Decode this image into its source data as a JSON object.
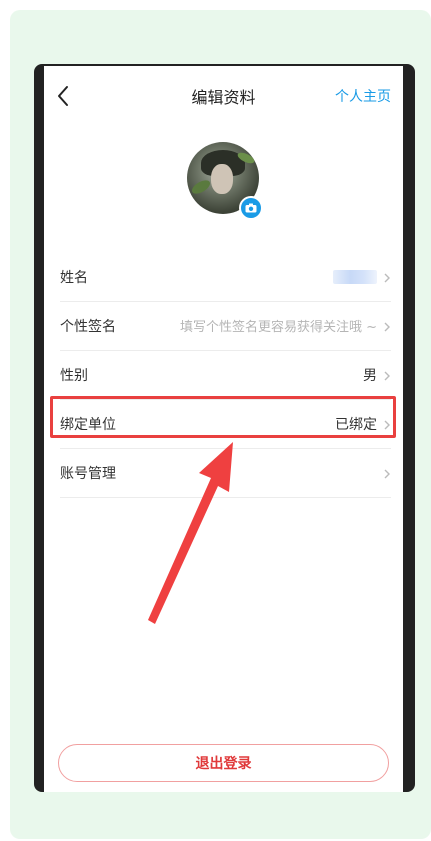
{
  "header": {
    "title": "编辑资料",
    "profile_link": "个人主页"
  },
  "profile": {
    "rows": [
      {
        "label": "姓名",
        "value": ""
      },
      {
        "label": "个性签名",
        "value": "填写个性签名更容易获得关注哦 ~"
      },
      {
        "label": "性别",
        "value": "男"
      },
      {
        "label": "绑定单位",
        "value": "已绑定"
      },
      {
        "label": "账号管理",
        "value": ""
      }
    ]
  },
  "logout": {
    "label": "退出登录"
  },
  "colors": {
    "accent": "#1a9be6",
    "highlight": "#e9403f",
    "background": "#e9f8ec"
  },
  "icons": {
    "back": "chevron-left-icon",
    "camera": "camera-icon",
    "chevron": "chevron-right-icon"
  }
}
